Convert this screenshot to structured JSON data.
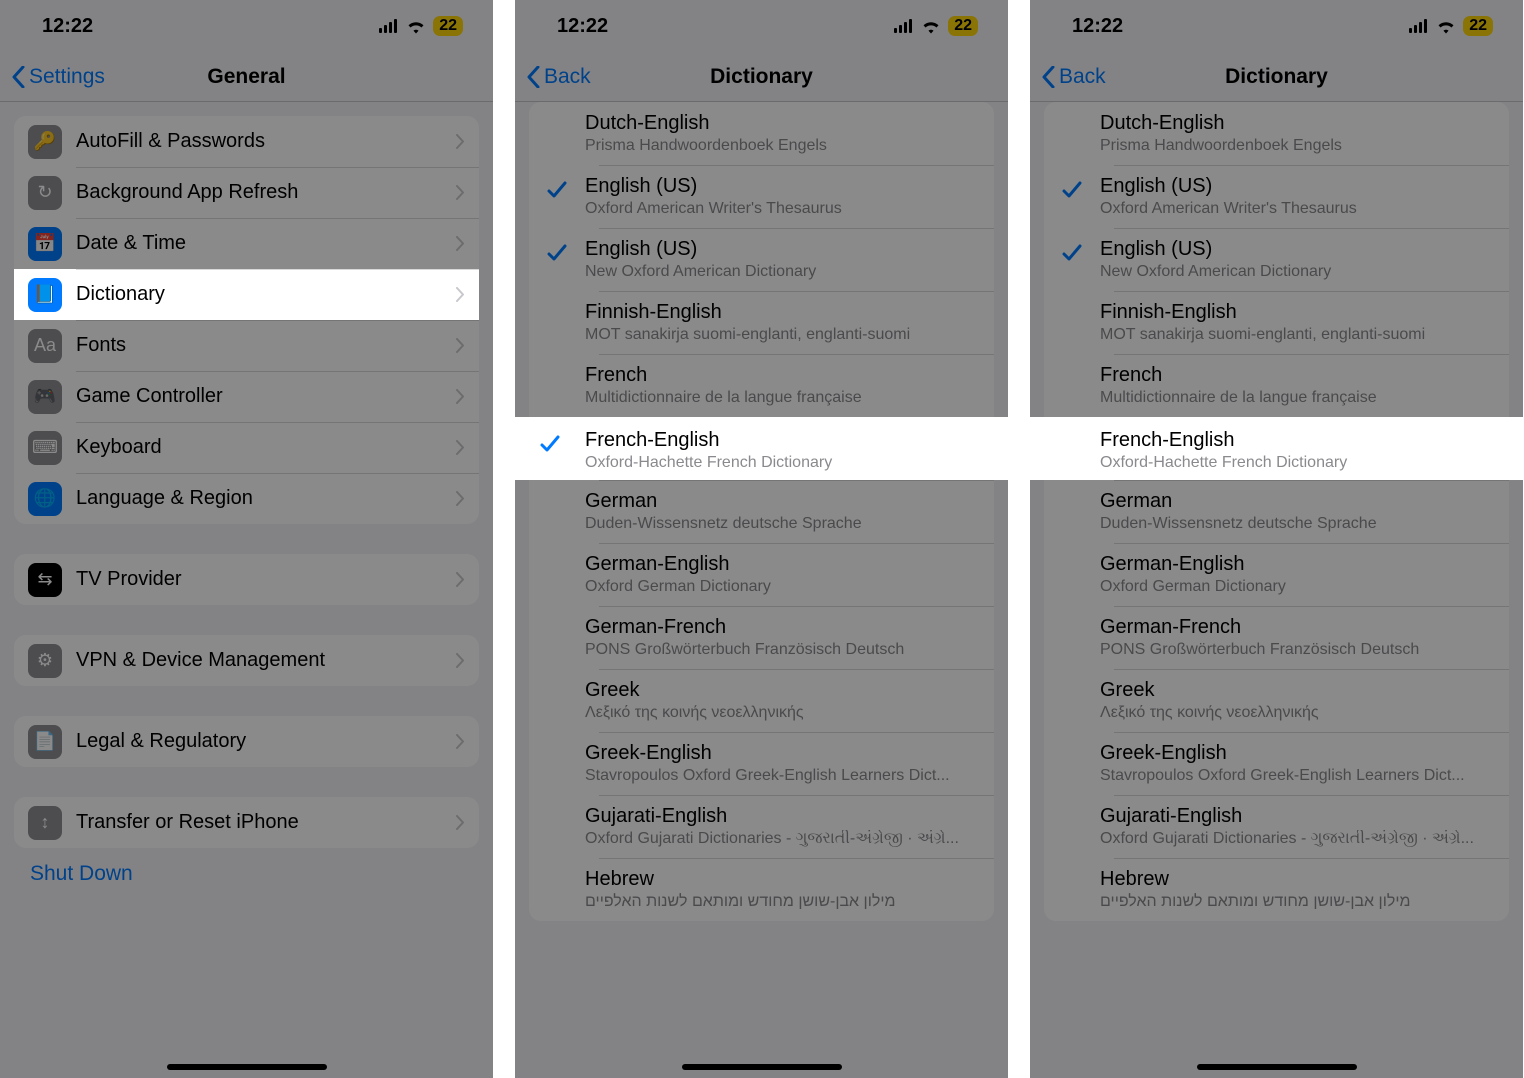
{
  "status": {
    "time": "12:22",
    "battery": "22"
  },
  "panel1": {
    "back": "Settings",
    "title": "General",
    "rows": [
      {
        "icon": "key-icon",
        "bg": "#8e8e93",
        "label": "AutoFill & Passwords"
      },
      {
        "icon": "refresh-icon",
        "bg": "#8e8e93",
        "label": "Background App Refresh"
      },
      {
        "icon": "calendar-icon",
        "bg": "#007aff",
        "label": "Date & Time"
      },
      {
        "icon": "book-icon",
        "bg": "#007aff",
        "label": "Dictionary",
        "highlight": true
      },
      {
        "icon": "font-icon",
        "bg": "#8e8e93",
        "label": "Fonts"
      },
      {
        "icon": "gamepad-icon",
        "bg": "#8e8e93",
        "label": "Game Controller"
      },
      {
        "icon": "keyboard-icon",
        "bg": "#8e8e93",
        "label": "Keyboard"
      },
      {
        "icon": "globe-icon",
        "bg": "#007aff",
        "label": "Language & Region"
      }
    ],
    "group2": [
      {
        "icon": "tv-icon",
        "bg": "#000000",
        "label": "TV Provider"
      }
    ],
    "group3": [
      {
        "icon": "gear-icon",
        "bg": "#8e8e93",
        "label": "VPN & Device Management"
      }
    ],
    "group4": [
      {
        "icon": "doc-icon",
        "bg": "#8e8e93",
        "label": "Legal & Regulatory"
      }
    ],
    "group5": [
      {
        "icon": "transfer-icon",
        "bg": "#8e8e93",
        "label": "Transfer or Reset iPhone"
      }
    ],
    "shutdown": "Shut Down"
  },
  "dictNav": {
    "back": "Back",
    "title": "Dictionary"
  },
  "dictRows": [
    {
      "title": "Dutch-English",
      "sub": "Prisma Handwoordenboek Engels",
      "checked": false
    },
    {
      "title": "English (US)",
      "sub": "Oxford American Writer's Thesaurus",
      "checked": true
    },
    {
      "title": "English (US)",
      "sub": "New Oxford American Dictionary",
      "checked": true
    },
    {
      "title": "Finnish-English",
      "sub": "MOT sanakirja suomi-englanti, englanti-suomi",
      "checked": false
    },
    {
      "title": "French",
      "sub": "Multidictionnaire de la langue française",
      "checked": false
    },
    {
      "title": "French-English",
      "sub": "Oxford-Hachette French Dictionary",
      "checked": false,
      "highlight": true
    },
    {
      "title": "German",
      "sub": "Duden-Wissensnetz deutsche Sprache",
      "checked": false
    },
    {
      "title": "German-English",
      "sub": "Oxford German Dictionary",
      "checked": false
    },
    {
      "title": "German-French",
      "sub": "PONS Großwörterbuch Französisch Deutsch",
      "checked": false
    },
    {
      "title": "Greek",
      "sub": "Λεξικό της κοινής νεοελληνικής",
      "checked": false
    },
    {
      "title": "Greek-English",
      "sub": "Stavropoulos Oxford Greek-English Learners Dict...",
      "checked": false
    },
    {
      "title": "Gujarati-English",
      "sub": "Oxford Gujarati Dictionaries - ગુજરાતી-અંગ્રેજી · અંગ્રે...",
      "checked": false
    },
    {
      "title": "Hebrew",
      "sub": "מילון אבן-שושן מחודש ומותאם לשנות האלפיים",
      "checked": false
    }
  ],
  "panel2": {
    "highlightChecked": true
  },
  "panel3": {
    "highlightChecked": false
  }
}
